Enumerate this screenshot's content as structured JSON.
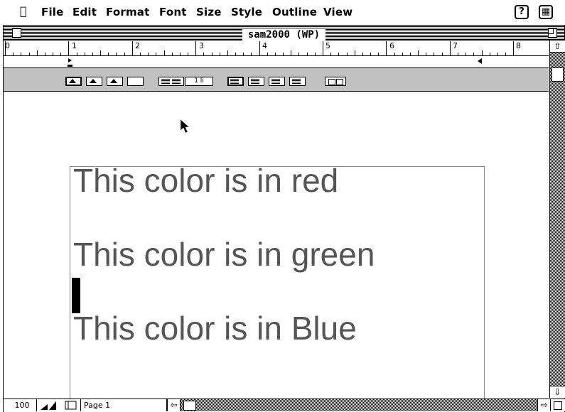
{
  "menubar": {
    "apple": "",
    "items": [
      "File",
      "Edit",
      "Format",
      "Font",
      "Size",
      "Style",
      "Outline",
      "View"
    ],
    "help_icon": "question-icon",
    "app_icon": "application-icon"
  },
  "window": {
    "title": "sam2000 (WP)"
  },
  "ruler": {
    "numbers": [
      "0",
      "1",
      "2",
      "3",
      "4",
      "5",
      "6",
      "7",
      "8"
    ]
  },
  "toolbar": {
    "line_spacing": "1 li"
  },
  "document": {
    "lines": [
      "This color is in red",
      "This color is  in green",
      "This color is in Blue"
    ]
  },
  "statusbar": {
    "zoom": "100",
    "page": "Page 1"
  }
}
